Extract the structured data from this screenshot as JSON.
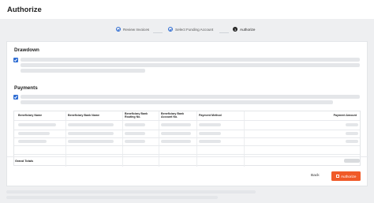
{
  "header": {
    "title": "Authorize"
  },
  "stepper": {
    "steps": [
      {
        "label": "Review Invoices",
        "state": "done"
      },
      {
        "label": "Select Funding Account",
        "state": "done"
      },
      {
        "label": "Authorize",
        "state": "current",
        "number": "3"
      }
    ]
  },
  "drawdown": {
    "title": "Drawdown"
  },
  "payments": {
    "title": "Payments"
  },
  "table": {
    "headers": {
      "beneficiary_name": "Beneficiary Name",
      "beneficiary_bank_name": "Beneficiary Bank Name",
      "beneficiary_bank_routing_line1": "Beneficiary Bank",
      "beneficiary_bank_routing_line2": "Routing No.",
      "beneficiary_bank_account_line1": "Beneficiary Bank",
      "beneficiary_bank_account_line2": "Account No.",
      "payment_method": "Payment Method",
      "payment_amount": "Payment Amount"
    },
    "grand_totals_label": "Grand Totals"
  },
  "actions": {
    "back_label": "Back",
    "authorize_label": "Authorize"
  },
  "colors": {
    "accent": "#2f6dd3",
    "primary_button": "#f05a28"
  }
}
